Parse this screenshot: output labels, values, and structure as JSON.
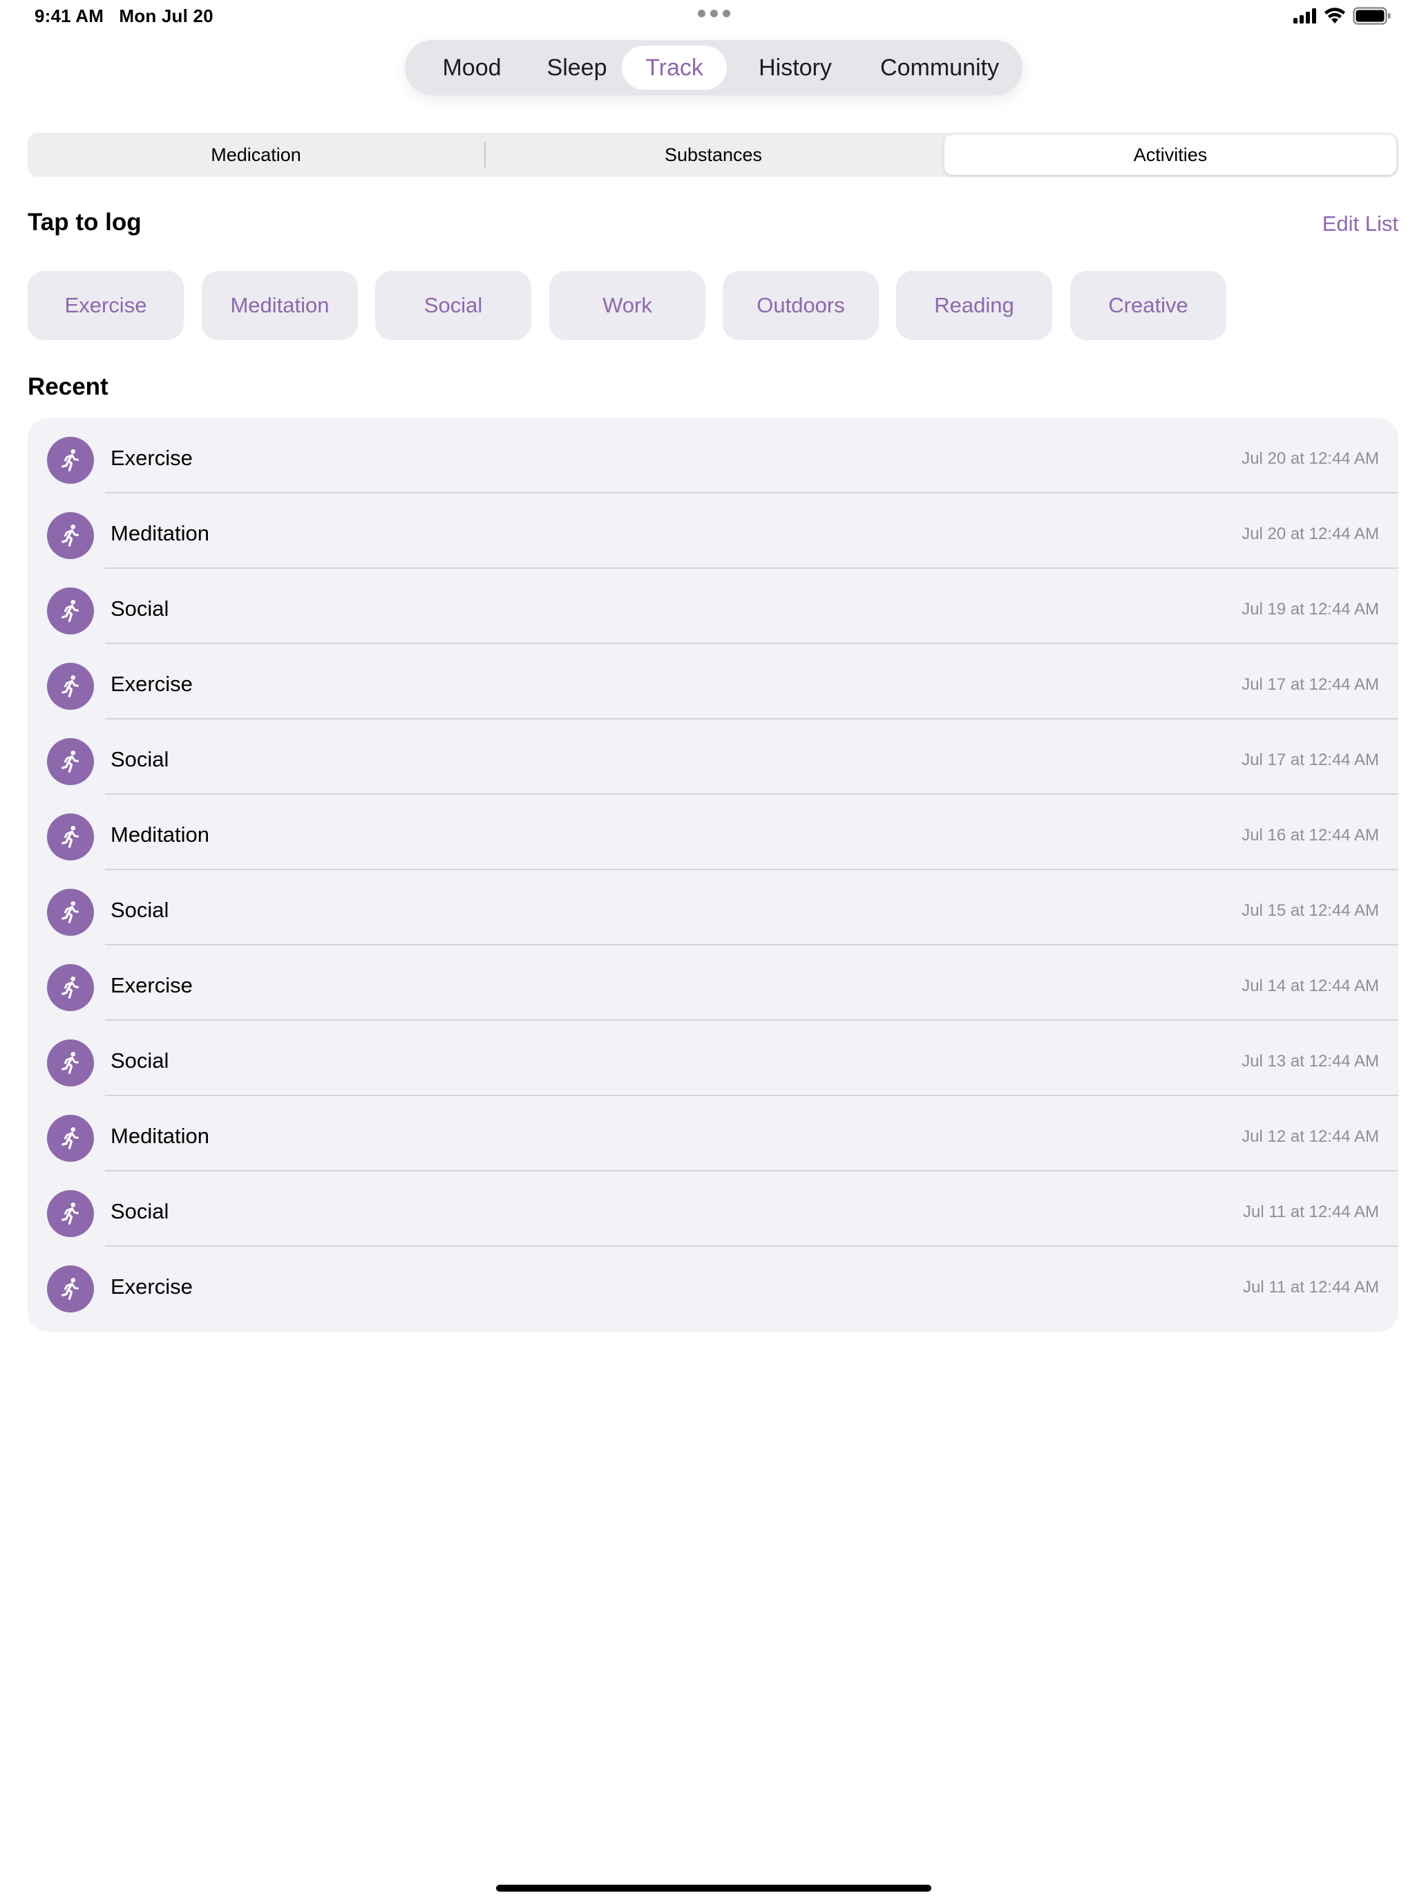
{
  "status_bar": {
    "time": "9:41 AM",
    "date": "Mon Jul 20",
    "icons": [
      "signal-icon",
      "wifi-icon",
      "battery-icon"
    ]
  },
  "top_tabs": [
    {
      "label": "Mood",
      "selected": false
    },
    {
      "label": "Sleep",
      "selected": false
    },
    {
      "label": "Track",
      "selected": true
    },
    {
      "label": "History",
      "selected": false
    },
    {
      "label": "Community",
      "selected": false
    }
  ],
  "segments": [
    {
      "label": "Medication",
      "selected": false
    },
    {
      "label": "Substances",
      "selected": false
    },
    {
      "label": "Activities",
      "selected": true
    }
  ],
  "tap_to_log": {
    "title": "Tap to log",
    "edit_label": "Edit List",
    "chips": [
      "Exercise",
      "Meditation",
      "Social",
      "Work",
      "Outdoors",
      "Reading",
      "Creative"
    ]
  },
  "recent": {
    "title": "Recent",
    "icon": "running-figure-icon",
    "items": [
      {
        "label": "Exercise",
        "time": "Jul 20 at 12:44 AM"
      },
      {
        "label": "Meditation",
        "time": "Jul 20 at 12:44 AM"
      },
      {
        "label": "Social",
        "time": "Jul 19 at 12:44 AM"
      },
      {
        "label": "Exercise",
        "time": "Jul 17 at 12:44 AM"
      },
      {
        "label": "Social",
        "time": "Jul 17 at 12:44 AM"
      },
      {
        "label": "Meditation",
        "time": "Jul 16 at 12:44 AM"
      },
      {
        "label": "Social",
        "time": "Jul 15 at 12:44 AM"
      },
      {
        "label": "Exercise",
        "time": "Jul 14 at 12:44 AM"
      },
      {
        "label": "Social",
        "time": "Jul 13 at 12:44 AM"
      },
      {
        "label": "Meditation",
        "time": "Jul 12 at 12:44 AM"
      },
      {
        "label": "Social",
        "time": "Jul 11 at 12:44 AM"
      },
      {
        "label": "Exercise",
        "time": "Jul 11 at 12:44 AM"
      }
    ]
  },
  "colors": {
    "accent": "#8d68ad",
    "chip_bg": "#ecebf1",
    "list_bg": "#f2f2f7",
    "secondary_text": "#8e8e93"
  }
}
